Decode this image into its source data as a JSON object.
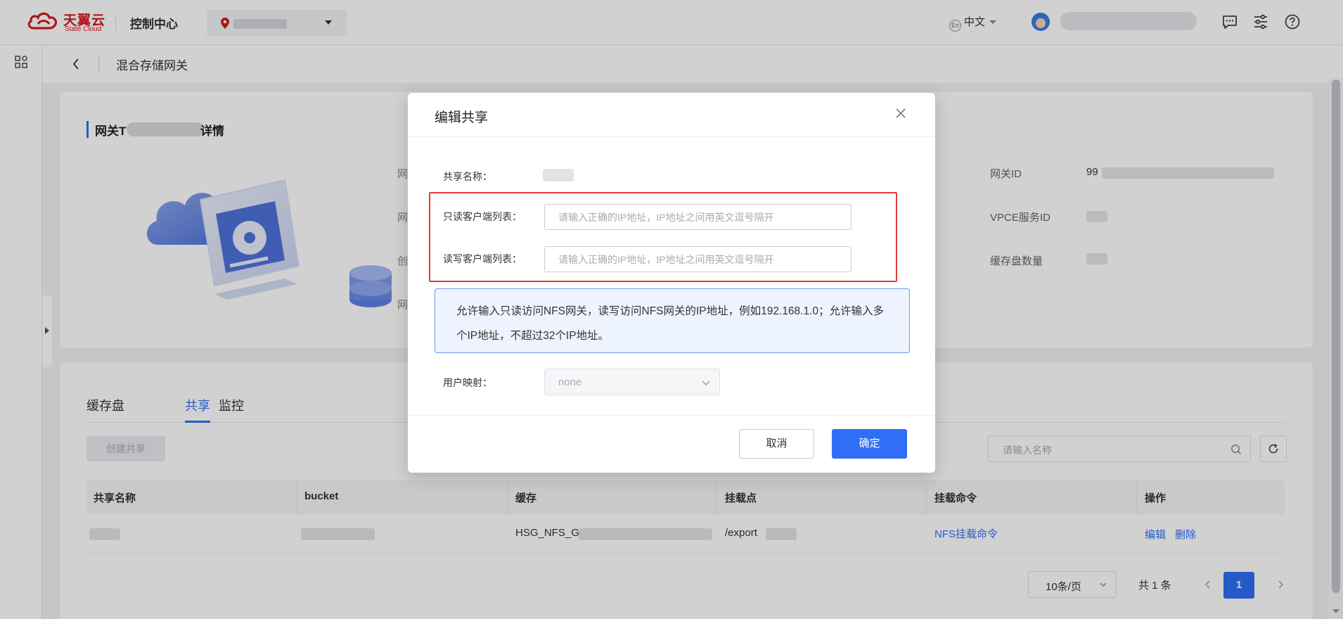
{
  "header": {
    "logo_cn": "天翼云",
    "logo_en": "State Cloud",
    "console_title": "控制中心",
    "language": "中文",
    "language_icon_text": "En"
  },
  "breadcrumb": {
    "title": "混合存储网关"
  },
  "detail": {
    "title_prefix": "网关T",
    "title_suffix": "详情",
    "left_labels": [
      "网",
      "网",
      "创",
      "网"
    ],
    "right_labels": [
      "网关ID",
      "VPCE服务ID",
      "缓存盘数量"
    ],
    "gateway_id_prefix": "99"
  },
  "share_panel": {
    "tabs": [
      {
        "label": "缓存盘",
        "active": false
      },
      {
        "label": "共享",
        "active": true
      },
      {
        "label": "监控",
        "active": false
      }
    ],
    "create_button": "创建共享",
    "search_placeholder": "请输入名称",
    "columns": [
      "共享名称",
      "bucket",
      "缓存",
      "挂载点",
      "挂载命令",
      "操作"
    ],
    "row": {
      "cache_prefix": "HSG_NFS_GV",
      "mount_point_prefix": "/export",
      "mount_command": "NFS挂载命令",
      "action_edit": "编辑",
      "action_delete": "删除"
    },
    "pagination": {
      "page_size": "10条/页",
      "total": "共 1 条",
      "current_page": "1"
    }
  },
  "modal": {
    "title": "编辑共享",
    "share_name_label": "共享名称：",
    "readonly_label": "只读客户端列表：",
    "readonly_placeholder": "请输入正确的IP地址，IP地址之间用英文逗号隔开",
    "readonly_value": "",
    "readwrite_label": "读写客户端列表：",
    "readwrite_placeholder": "请输入正确的IP地址，IP地址之间用英文逗号隔开",
    "readwrite_value": "",
    "info_text": "允许输入只读访问NFS网关，读写访问NFS网关的IP地址，例如192.168.1.0；允许输入多个IP地址，不超过32个IP地址。",
    "user_mapping_label": "用户映射：",
    "user_mapping_value": "none",
    "cancel_button": "取消",
    "confirm_button": "确定"
  },
  "colors": {
    "primary": "#2f6ef6",
    "brand_red": "#d71920",
    "highlight_red": "#e53b3b"
  }
}
